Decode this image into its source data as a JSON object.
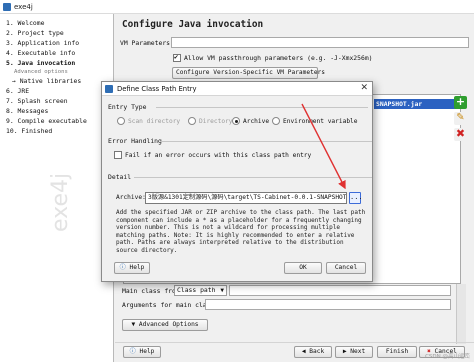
{
  "window": {
    "title": "exe4j"
  },
  "sidebar": {
    "items": [
      {
        "label": "1. Welcome",
        "style": "normal"
      },
      {
        "label": "2. Project type",
        "style": "normal"
      },
      {
        "label": "3. Application info",
        "style": "normal"
      },
      {
        "label": "4. Executable info",
        "style": "normal"
      },
      {
        "label": "5. Java invocation",
        "style": "current"
      },
      {
        "label": "Advanced options",
        "style": "sub"
      },
      {
        "label": "→ Native libraries",
        "style": "sub-item"
      },
      {
        "label": "6. JRE",
        "style": "normal"
      },
      {
        "label": "7. Splash screen",
        "style": "normal"
      },
      {
        "label": "8. Messages",
        "style": "normal"
      },
      {
        "label": "9. Compile executable",
        "style": "normal"
      },
      {
        "label": "10. Finished",
        "style": "normal"
      }
    ],
    "watermark": "exe4j"
  },
  "main": {
    "page_title": "Configure Java invocation",
    "vm_parameters_label": "VM Parameters:",
    "vm_passthrough_label": "Allow VM passthrough parameters (e.g. -J-Xmx256m)",
    "configure_vm_button": "Configure Version-Specific VM Parameters",
    "selected_entry": "SNAPSHOT.jar",
    "main_class_from_label": "Main class from",
    "main_class_from_value": "Class path",
    "arguments_label": "Arguments for main class:",
    "advanced_options_button": "Advanced Options",
    "help_button": "Help",
    "back_button": "Back",
    "next_button": "Next",
    "finish_button": "Finish",
    "cancel_button": "Cancel"
  },
  "dialog": {
    "title": "Define Class Path Entry",
    "entry_type_label": "Entry Type",
    "entry_types": [
      {
        "label": "Scan directory",
        "selected": false,
        "enabled": false
      },
      {
        "label": "Directory",
        "selected": false,
        "enabled": false
      },
      {
        "label": "Archive",
        "selected": true,
        "enabled": true
      },
      {
        "label": "Environment variable",
        "selected": false,
        "enabled": true
      }
    ],
    "error_handling_label": "Error Handling",
    "fail_on_error_label": "Fail if an error occurs with this class path entry",
    "detail_label": "Detail",
    "archive_label": "Archive:",
    "archive_value": "3版源&1301定制源码\\源码\\target\\TS-Cabinet-0.0.1-SNAPSHOT.jar",
    "browse_label": "...",
    "help_text": "Add the specified JAR or ZIP archive to the class path. The last path component can include a * as a placeholder for a frequently changing version number. This is not a wildcard for processing multiple matching paths. Note: It is highly recommended to enter a relative path. Paths are always interpreted relative to the distribution source directory.",
    "help_button": "Help",
    "ok_button": "OK",
    "cancel_button": "Cancel"
  },
  "footer": {
    "credit": "CSDN @高山远峦"
  },
  "colors": {
    "selection": "#2b61c1",
    "arrow": "#e03131",
    "add": "#2f9e2f"
  }
}
